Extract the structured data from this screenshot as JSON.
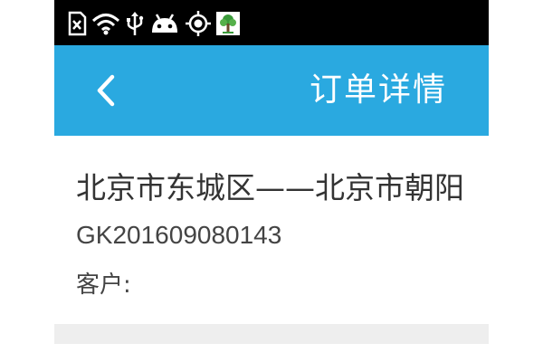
{
  "status_bar": {
    "icons": [
      "sd-card-icon",
      "wifi-icon",
      "usb-icon",
      "android-icon",
      "gps-icon",
      "app-tree-icon"
    ]
  },
  "header": {
    "title": "订单详情",
    "back_icon": "chevron-left-icon"
  },
  "order": {
    "route": "北京市东城区——北京市朝阳",
    "order_no": "GK201609080143",
    "customer_label": "客户:"
  },
  "colors": {
    "header_bg": "#2aa9e0",
    "status_bar_bg": "#000000",
    "divider_bg": "#eeeeee"
  }
}
